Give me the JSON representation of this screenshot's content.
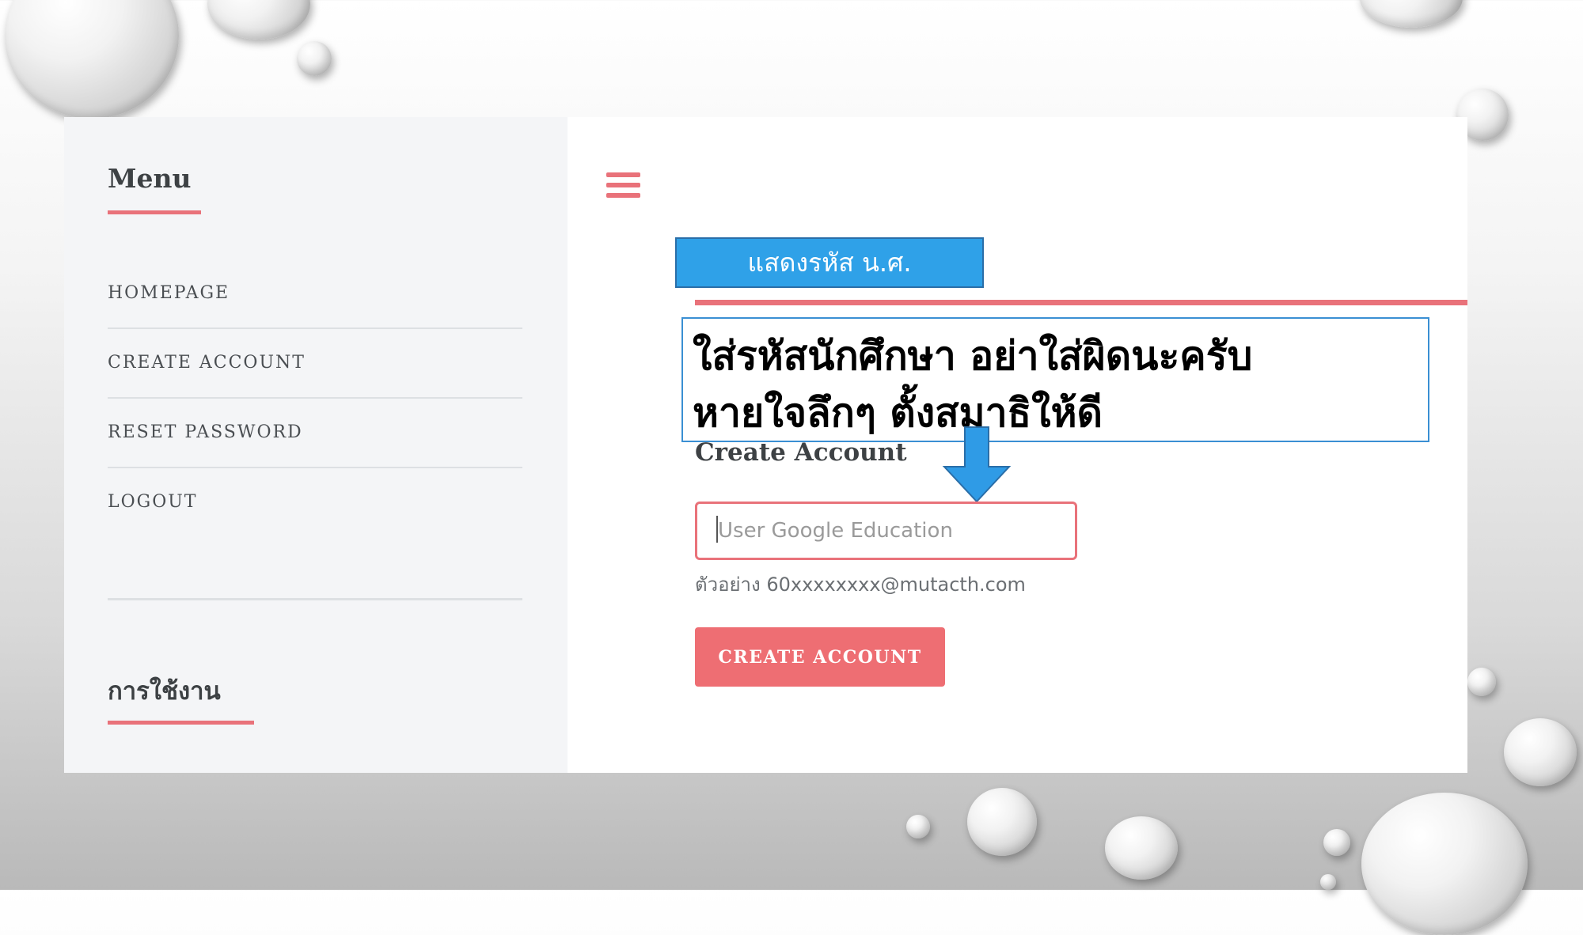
{
  "sidebar": {
    "title": "Menu",
    "items": [
      {
        "label": "HOMEPAGE"
      },
      {
        "label": "CREATE ACCOUNT"
      },
      {
        "label": "RESET PASSWORD"
      },
      {
        "label": "LOGOUT"
      }
    ],
    "section_title": "การใช้งาน"
  },
  "header": {
    "menu_icon": "hamburger-icon"
  },
  "annotation": {
    "label": "แสดงรหัส น.ศ.",
    "callout_line1": "ใส่รหัสนักศึกษา อย่าใส่ผิดนะครับ",
    "callout_line2": "หายใจลึกๆ ตั้งสมาธิให้ดี",
    "arrow_icon": "arrow-down-icon"
  },
  "form": {
    "title": "Create Account",
    "input_placeholder": "User Google Education",
    "input_value": "",
    "helper": "ตัวอย่าง 60xxxxxxxx@mutacth.com",
    "submit_label": "CREATE ACCOUNT"
  },
  "colors": {
    "accent": "#e9727a",
    "button": "#ee6e73",
    "label_blue": "#2fa1e8",
    "sidebar_bg": "#f4f5f7"
  }
}
